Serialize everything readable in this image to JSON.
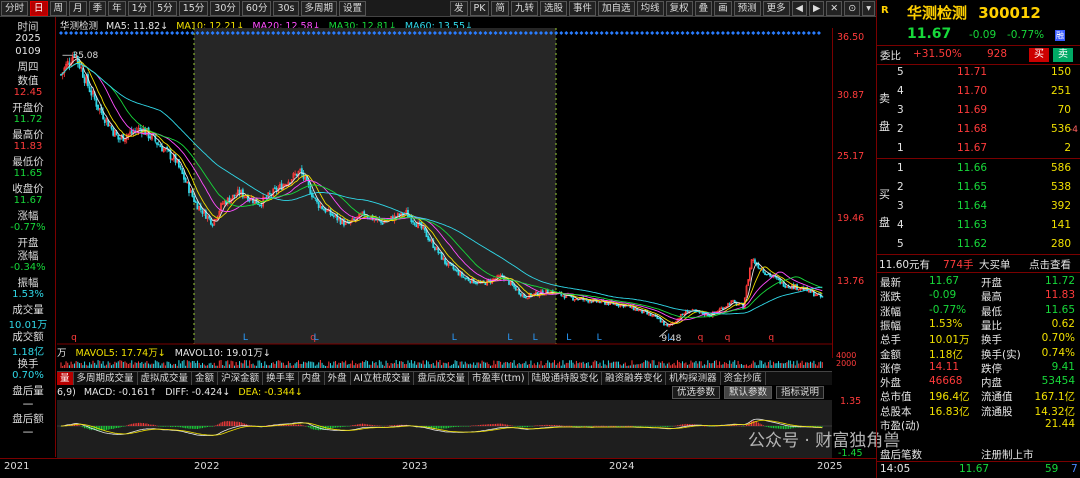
{
  "toolbar": {
    "items": [
      "分时",
      "日",
      "周",
      "月",
      "季",
      "年",
      "1分",
      "5分",
      "15分",
      "30分",
      "60分",
      "30s",
      "多周期",
      "设置"
    ],
    "active_index": 1,
    "right_items": [
      "发",
      "PK",
      "简",
      "九转",
      "选股",
      "事件",
      "加自选",
      "均线",
      "复权",
      "叠",
      "画",
      "预测",
      "更多"
    ],
    "window_controls": [
      "◀",
      "▶",
      "✕",
      "⊙",
      "▾"
    ]
  },
  "left_panel": {
    "time_label": "时间",
    "date_year": "2025",
    "date_md": "0109",
    "weekday": "周四",
    "value_label": "数值",
    "value": "12.45",
    "open_label": "开盘价",
    "open": "11.72",
    "high_label": "最高价",
    "high": "11.83",
    "low_label": "最低价",
    "low": "11.65",
    "close_label": "收盘价",
    "close": "11.67",
    "chg_label": "涨幅",
    "chg": "-0.77%",
    "open_chg_label1": "开盘",
    "open_chg_label2": "涨幅",
    "open_chg": "-0.34%",
    "amp_label": "振幅",
    "amp": "1.53%",
    "vol_label": "成交量",
    "vol": "10.01万",
    "amt_label": "成交额",
    "amt": "1.18亿",
    "turn_label": "换手",
    "turn": "0.70%",
    "after_vol_label": "盘后量",
    "after_vol": "一",
    "after_amt_label": "盘后额",
    "after_amt": "一"
  },
  "main_legend": {
    "name": "华测检测",
    "ma5": "MA5: 11.82↓",
    "ma10": "MA10: 12.21↓",
    "ma20": "MA20: 12.58↓",
    "ma30": "MA30: 12.81↓",
    "ma60": "MA60: 13.55↓"
  },
  "price_axis": [
    "36.50",
    "30.87",
    "25.17",
    "19.46",
    "13.76"
  ],
  "annotations": {
    "high": "35.08",
    "low": "9.48"
  },
  "volume_legend": {
    "unit": "万",
    "mavol5": "MAVOL5: 17.74万↓",
    "mavol10": "MAVOL10: 19.01万↓",
    "right_vals": [
      "4000",
      "2000"
    ]
  },
  "indicator_tabs": [
    "量",
    "多周期成交量",
    "虚拟成交量",
    "金额",
    "沪深金额",
    "换手率",
    "内盘",
    "外盘",
    "AI立桩成交量",
    "盘后成交量",
    "市盈率(ttm)",
    "陆股通持股变化",
    "融资融券变化",
    "机构探测器",
    "资金抄底"
  ],
  "macd_legend": {
    "params": "6,9)",
    "macd": "MACD: -0.161↑",
    "diff": "DIFF: -0.424↓",
    "dea": "DEA: -0.344↓"
  },
  "macd_buttons": [
    "优选参数",
    "默认参数",
    "指标说明"
  ],
  "macd_axis": [
    "1.35",
    "-1.45"
  ],
  "x_axis": [
    "2021",
    "2022",
    "2023",
    "2024",
    "2025"
  ],
  "watermark": "公众号 · 财富独角兽",
  "colors": {
    "up": "#ff3b3b",
    "down": "#17d93a",
    "ma5": "#e6e6e6",
    "ma10": "#f0e000",
    "ma20": "#ff4dff",
    "ma30": "#17d93a",
    "ma60": "#30d8e8"
  },
  "right_panel": {
    "r_tag": "R",
    "stock_name": "华测检测",
    "code": "300012",
    "price": "11.67",
    "change": "-0.09",
    "change_pct": "-0.77%",
    "rong_tag": "融",
    "weibi_label": "委比",
    "weibi": "+31.50%",
    "weicha": "928",
    "buy_label": "买",
    "sell_label": "卖",
    "sell_side_label": [
      "卖",
      "盘"
    ],
    "buy_side_label": [
      "买",
      "盘"
    ],
    "asks": [
      {
        "level": "5",
        "price": "11.71",
        "vol": "150"
      },
      {
        "level": "4",
        "price": "11.70",
        "vol": "251"
      },
      {
        "level": "3",
        "price": "11.69",
        "vol": "70"
      },
      {
        "level": "2",
        "price": "11.68",
        "vol": "536"
      },
      {
        "level": "1",
        "price": "11.67",
        "vol": "2"
      }
    ],
    "bids": [
      {
        "level": "1",
        "price": "11.66",
        "vol": "586"
      },
      {
        "level": "2",
        "price": "11.65",
        "vol": "538"
      },
      {
        "level": "3",
        "price": "11.64",
        "vol": "392"
      },
      {
        "level": "4",
        "price": "11.63",
        "vol": "141"
      },
      {
        "level": "5",
        "price": "11.62",
        "vol": "280"
      }
    ],
    "ask2_side": "-4",
    "big_order": {
      "price": "11.60元有",
      "vol": "774手",
      "label": "大买单",
      "action": "点击查看"
    },
    "stats": [
      {
        "l1": "最新",
        "v1": "11.67",
        "c1": "green",
        "l2": "开盘",
        "v2": "11.72",
        "c2": "green"
      },
      {
        "l1": "涨跌",
        "v1": "-0.09",
        "c1": "green",
        "l2": "最高",
        "v2": "11.83",
        "c2": "red"
      },
      {
        "l1": "涨幅",
        "v1": "-0.77%",
        "c1": "green",
        "l2": "最低",
        "v2": "11.65",
        "c2": "green"
      },
      {
        "l1": "振幅",
        "v1": "1.53%",
        "c1": "yellow",
        "l2": "量比",
        "v2": "0.62",
        "c2": "yellow"
      },
      {
        "l1": "总手",
        "v1": "10.01万",
        "c1": "yellow",
        "l2": "换手",
        "v2": "0.70%",
        "c2": "yellow"
      },
      {
        "l1": "金额",
        "v1": "1.18亿",
        "c1": "yellow",
        "l2": "换手(实)",
        "v2": "0.74%",
        "c2": "yellow"
      },
      {
        "l1": "涨停",
        "v1": "14.11",
        "c1": "red",
        "l2": "跌停",
        "v2": "9.41",
        "c2": "green"
      },
      {
        "l1": "外盘",
        "v1": "46668",
        "c1": "red",
        "l2": "内盘",
        "v2": "53454",
        "c2": "green"
      },
      {
        "l1": "总市值",
        "v1": "196.4亿",
        "c1": "yellow",
        "l2": "流通值",
        "v2": "167.1亿",
        "c2": "yellow"
      },
      {
        "l1": "总股本",
        "v1": "16.83亿",
        "c1": "yellow",
        "l2": "流通股",
        "v2": "14.32亿",
        "c2": "yellow"
      },
      {
        "l1": "市盈(动)",
        "v1": "",
        "c1": "yellow",
        "l2": "",
        "v2": "21.44",
        "c2": "yellow"
      },
      {
        "l1": "",
        "v1": "",
        "c1": "yellow",
        "l2": "",
        "v2": "",
        "c2": "yellow"
      },
      {
        "l1": "盘后笔数",
        "v1": "",
        "c1": "white",
        "l2": "注册制上市",
        "v2": "",
        "c2": "white"
      }
    ],
    "last_trade": {
      "time": "14:05",
      "price": "11.67",
      "vol": "59",
      "flag": "7"
    }
  }
}
